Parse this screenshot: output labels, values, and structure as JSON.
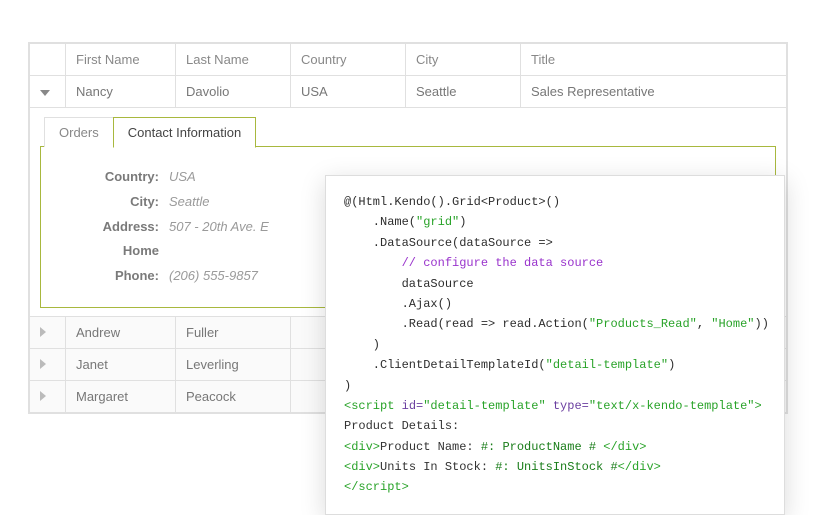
{
  "grid": {
    "headers": {
      "first": "First Name",
      "last": "Last Name",
      "country": "Country",
      "city": "City",
      "title": "Title"
    },
    "rows": [
      {
        "first": "Nancy",
        "last": "Davolio",
        "country": "USA",
        "city": "Seattle",
        "title": "Sales Representative",
        "expanded": true
      },
      {
        "first": "Andrew",
        "last": "Fuller",
        "country": "",
        "city": "",
        "title": "",
        "expanded": false
      },
      {
        "first": "Janet",
        "last": "Leverling",
        "country": "",
        "city": "",
        "title": "",
        "expanded": false
      },
      {
        "first": "Margaret",
        "last": "Peacock",
        "country": "",
        "city": "",
        "title": "",
        "expanded": false
      }
    ]
  },
  "tabs": {
    "orders": "Orders",
    "contact": "Contact Information"
  },
  "contact": {
    "country_label": "Country:",
    "country_value": "USA",
    "city_label": "City:",
    "city_value": "Seattle",
    "address_label": "Address:",
    "address_value": "507 - 20th Ave. E",
    "home_label": "Home",
    "phone_label": "Phone:",
    "phone_value": "(206) 555-9857"
  },
  "code": {
    "l01a": "@(Html.Kendo().Grid<Product>()",
    "l02a": "    .Name(",
    "l02b": "\"grid\"",
    "l02c": ")",
    "l03a": "    .DataSource(dataSource =>",
    "l04a": "        ",
    "l04b": "// configure the data source",
    "l05a": "        dataSource",
    "l06a": "        .Ajax()",
    "l07a": "        .Read(read => read.Action(",
    "l07b": "\"Products_Read\"",
    "l07c": ", ",
    "l07d": "\"Home\"",
    "l07e": "))",
    "l08a": "    )",
    "l09a": "    .ClientDetailTemplateId(",
    "l09b": "\"detail-template\"",
    "l09c": ")",
    "l10a": ")",
    "l11a": "<script",
    "l11b": " id=",
    "l11c": "\"detail-template\"",
    "l11d": " type=",
    "l11e": "\"text/x-kendo-template\"",
    "l11f": ">",
    "l12a": "Product Details:",
    "l13a": "<div>",
    "l13b": "Product Name: ",
    "l13c": "#: ProductName #",
    "l13d": " </div>",
    "l14a": "<div>",
    "l14b": "Units In Stock: ",
    "l14c": "#: UnitsInStock #",
    "l14d": "</div>",
    "l15a": "</",
    "l15b": "script",
    "l15c": ">"
  }
}
